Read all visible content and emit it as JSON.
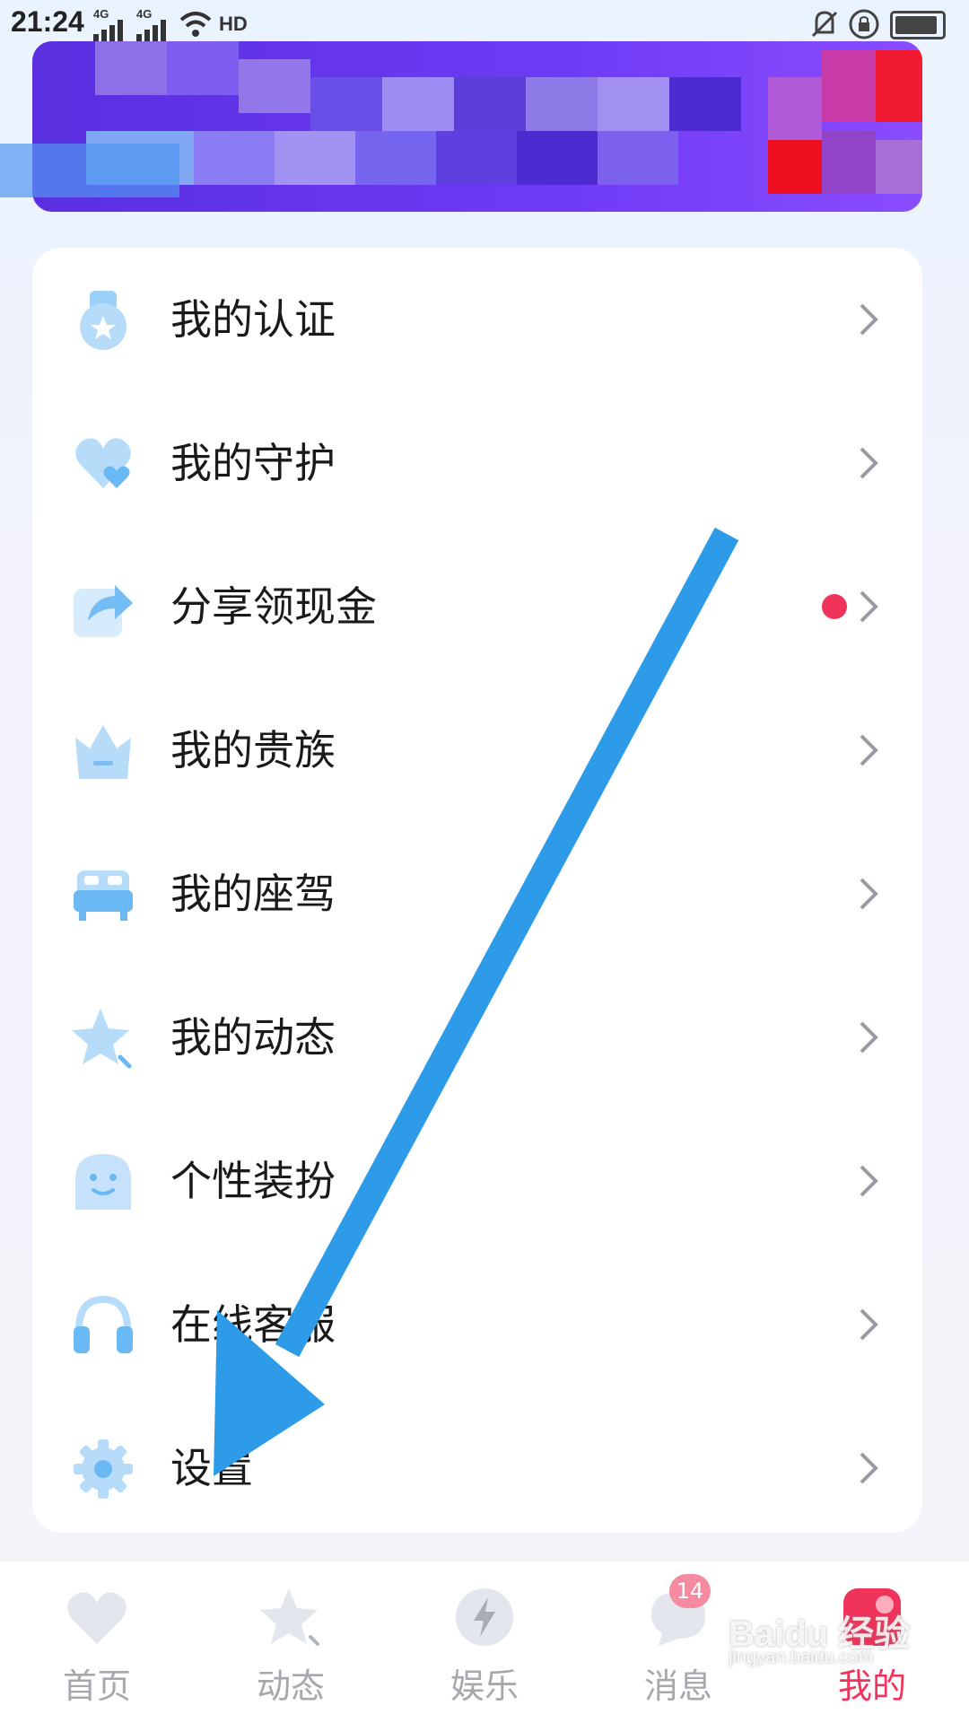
{
  "status_bar": {
    "time": "21:24",
    "net1": "4G",
    "net2": "4G",
    "hd": "HD"
  },
  "menu": {
    "items": [
      {
        "label": "我的认证",
        "icon": "medal-icon"
      },
      {
        "label": "我的守护",
        "icon": "heart-icon"
      },
      {
        "label": "分享领现金",
        "icon": "share-icon",
        "badge_dot": true
      },
      {
        "label": "我的贵族",
        "icon": "crown-icon"
      },
      {
        "label": "我的座驾",
        "icon": "car-icon"
      },
      {
        "label": "我的动态",
        "icon": "star-icon"
      },
      {
        "label": "个性装扮",
        "icon": "ghost-icon"
      },
      {
        "label": "在线客服",
        "icon": "headphones-icon"
      },
      {
        "label": "设置",
        "icon": "gear-icon"
      }
    ]
  },
  "tabbar": {
    "tabs": [
      {
        "label": "首页",
        "icon": "heart-icon"
      },
      {
        "label": "动态",
        "icon": "star-icon"
      },
      {
        "label": "娱乐",
        "icon": "lightning-icon"
      },
      {
        "label": "消息",
        "icon": "chat-icon",
        "badge": "14"
      },
      {
        "label": "我的",
        "icon": "profile-icon",
        "active": true
      }
    ]
  },
  "watermark": {
    "line1": "Baidu 经验",
    "line2": "jingyan.baidu.com"
  },
  "colors": {
    "accent": "#f0335a",
    "icon_blue": "#8ec8f6",
    "arrow": "#2e9be8",
    "banner": "#6a38f0"
  }
}
